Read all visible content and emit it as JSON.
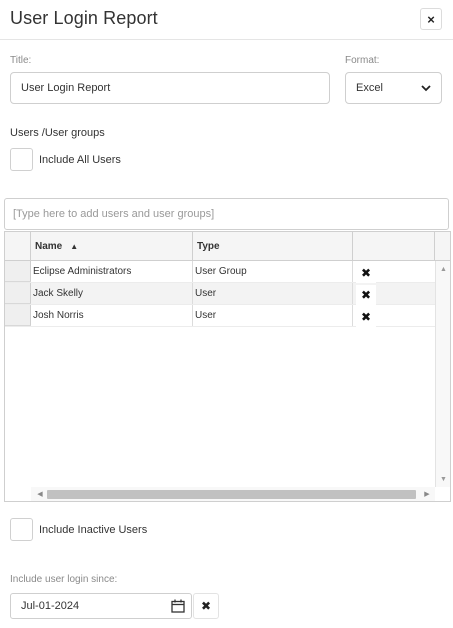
{
  "dialog": {
    "title": "User Login Report",
    "close_icon": "×"
  },
  "form": {
    "title_label": "Title:",
    "title_value": "User Login Report",
    "format_label": "Format:",
    "format_selected": "Excel",
    "users_section_label": "Users /User groups",
    "include_all_users_label": "Include All Users",
    "include_all_users_checked": false,
    "search_placeholder": "[Type here to add users and user groups]",
    "include_inactive_label": "Include Inactive Users",
    "include_inactive_checked": false,
    "login_since_label": "Include user login since:",
    "login_since_value": "Jul-01-2024"
  },
  "grid": {
    "columns": [
      {
        "label": "Name",
        "sort": "ascending",
        "sort_icon": "▲"
      },
      {
        "label": "Type"
      },
      {
        "label": ""
      }
    ],
    "rows": [
      {
        "name": "Eclipse Administrators",
        "type": "User Group"
      },
      {
        "name": "Jack Skelly",
        "type": "User"
      },
      {
        "name": "Josh Norris",
        "type": "User"
      }
    ],
    "remove_icon": "✖",
    "scroll_up_icon": "▲",
    "scroll_down_icon": "▼",
    "scroll_left_icon": "◀",
    "scroll_right_icon": "▶"
  },
  "icons": {
    "dropdown_icon": "chevron-down-icon",
    "calendar_icon": "calendar-icon",
    "clear_icon": "✖"
  }
}
